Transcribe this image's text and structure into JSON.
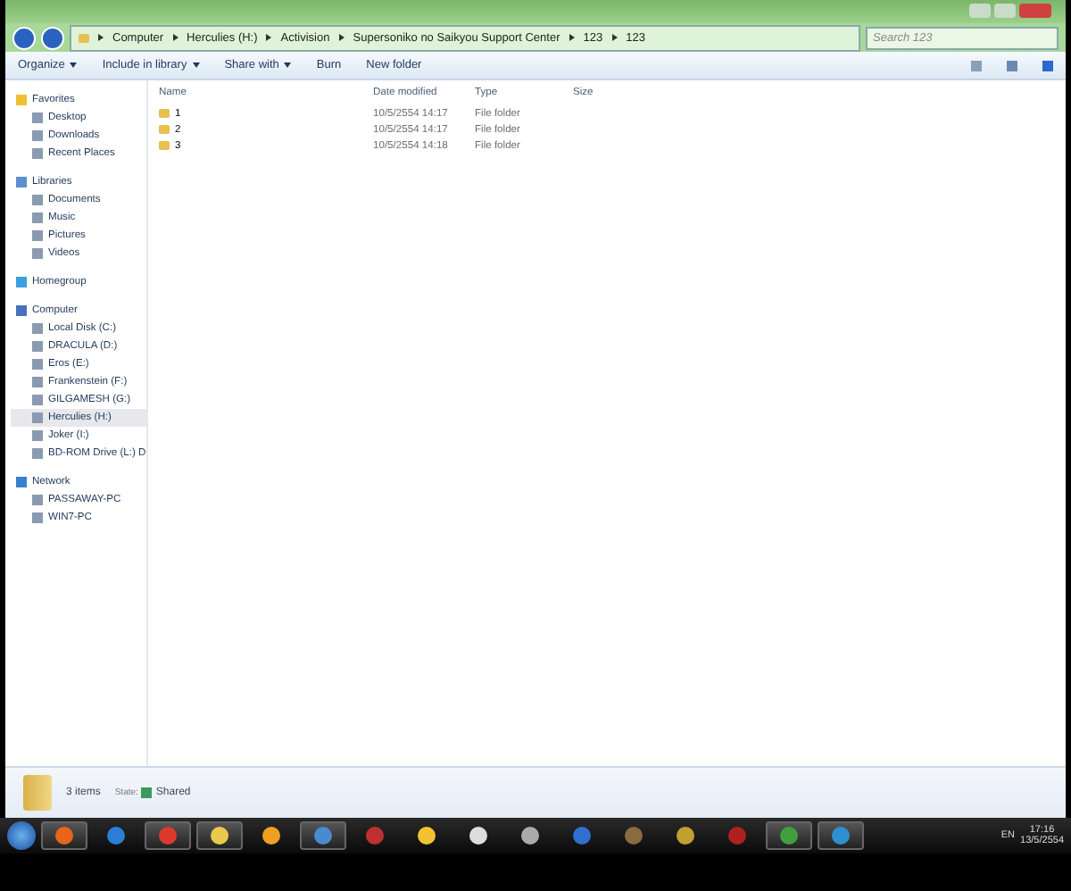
{
  "address_bar": {
    "breadcrumbs": [
      "Computer",
      "Herculies (H:)",
      "Activision",
      "Supersoniko no Saikyou Support Center",
      "123",
      "123"
    ]
  },
  "search": {
    "placeholder": "Search 123"
  },
  "toolbar": {
    "buttons": [
      {
        "label": "Organize",
        "dropdown": true
      },
      {
        "label": "Include in library",
        "dropdown": true
      },
      {
        "label": "Share with",
        "dropdown": true
      },
      {
        "label": "Burn",
        "dropdown": false
      },
      {
        "label": "New folder",
        "dropdown": false
      }
    ]
  },
  "sidebar": {
    "groups": [
      {
        "label": "Favorites",
        "kind": "favorites",
        "children": [
          {
            "label": "Desktop",
            "selected": false
          },
          {
            "label": "Downloads",
            "selected": false
          },
          {
            "label": "Recent Places",
            "selected": false
          }
        ]
      },
      {
        "label": "Libraries",
        "kind": "libraries",
        "children": [
          {
            "label": "Documents",
            "selected": false
          },
          {
            "label": "Music",
            "selected": false
          },
          {
            "label": "Pictures",
            "selected": false
          },
          {
            "label": "Videos",
            "selected": false
          }
        ]
      },
      {
        "label": "Homegroup",
        "kind": "homegroup"
      },
      {
        "label": "Computer",
        "kind": "computer",
        "children": [
          {
            "label": "Local Disk (C:)",
            "selected": false
          },
          {
            "label": "DRACULA (D:)",
            "selected": false
          },
          {
            "label": "Eros (E:)",
            "selected": false
          },
          {
            "label": "Frankenstein (F:)",
            "selected": false
          },
          {
            "label": "GILGAMESH (G:)",
            "selected": false
          },
          {
            "label": "Herculies (H:)",
            "selected": true
          },
          {
            "label": "Joker (I:)",
            "selected": false
          },
          {
            "label": "BD-ROM Drive (L:) D",
            "selected": false
          }
        ]
      },
      {
        "label": "Network",
        "kind": "network",
        "children": [
          {
            "label": "PASSAWAY-PC",
            "selected": false
          },
          {
            "label": "WIN7-PC",
            "selected": false
          }
        ]
      }
    ]
  },
  "table": {
    "columns": [
      "Name",
      "Date modified",
      "Type",
      "Size"
    ],
    "rows": [
      {
        "name": "1",
        "date": "10/5/2554 14:17",
        "type": "File folder"
      },
      {
        "name": "2",
        "date": "10/5/2554 14:17",
        "type": "File folder"
      },
      {
        "name": "3",
        "date": "10/5/2554 14:18",
        "type": "File folder"
      }
    ]
  },
  "status_bar": {
    "count": "3 items",
    "state_label": "State:",
    "state": "Shared"
  },
  "taskbar": {
    "apps": [
      {
        "color": "#e8651a",
        "running": true
      },
      {
        "color": "#2a7fd4",
        "running": false
      },
      {
        "color": "#d93a2b",
        "running": true
      },
      {
        "color": "#e9c94a",
        "running": true
      },
      {
        "color": "#f0a020",
        "running": false
      },
      {
        "color": "#4a8ad0",
        "running": true
      },
      {
        "color": "#c03030",
        "running": false
      },
      {
        "color": "#f2c230",
        "running": false
      },
      {
        "color": "#dddddd",
        "running": false
      },
      {
        "color": "#aaaaaa",
        "running": false
      },
      {
        "color": "#3070d0",
        "running": false
      },
      {
        "color": "#8a6a40",
        "running": false
      },
      {
        "color": "#c0a030",
        "running": false
      },
      {
        "color": "#b02020",
        "running": false
      },
      {
        "color": "#40a040",
        "running": true
      },
      {
        "color": "#2f8fd0",
        "running": true
      }
    ],
    "language": "EN",
    "time": "17:16",
    "date": "13/5/2554"
  }
}
